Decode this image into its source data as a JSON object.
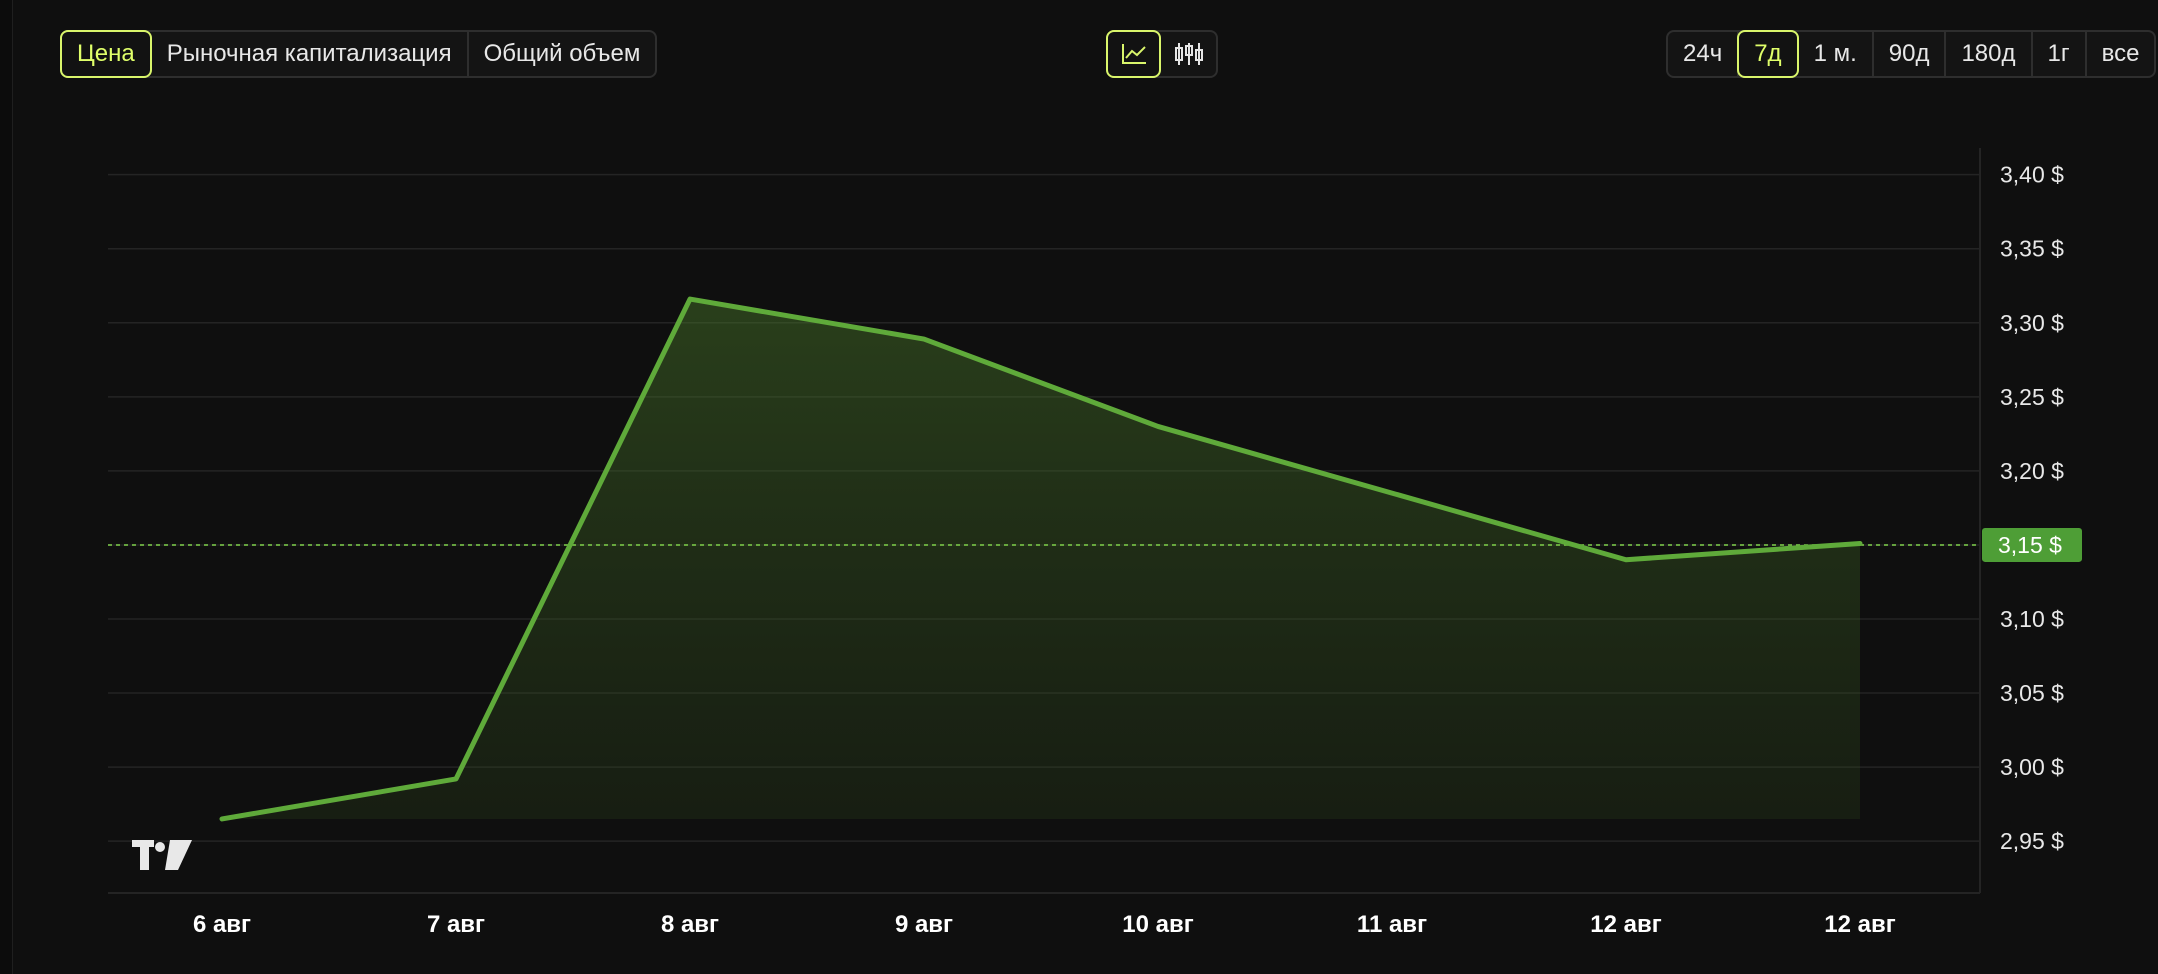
{
  "metric_tabs": [
    {
      "label": "Цена",
      "active": true
    },
    {
      "label": "Рыночная капитализация",
      "active": false
    },
    {
      "label": "Общий объем",
      "active": false
    }
  ],
  "view_toggle": [
    {
      "icon": "line-chart-icon",
      "active": true
    },
    {
      "icon": "candlestick-chart-icon",
      "active": false
    }
  ],
  "range_tabs": [
    {
      "label": "24ч",
      "active": false
    },
    {
      "label": "7д",
      "active": true
    },
    {
      "label": "1 м.",
      "active": false
    },
    {
      "label": "90д",
      "active": false
    },
    {
      "label": "180д",
      "active": false
    },
    {
      "label": "1г",
      "active": false
    },
    {
      "label": "все",
      "active": false
    }
  ],
  "colors": {
    "accent": "#d9f56b",
    "line": "#5faa3a",
    "price_tag": "#4e9e36",
    "background": "#0f0f0f"
  },
  "chart_data": {
    "type": "area",
    "x": [
      "6 авг",
      "7 авг",
      "8 авг",
      "9 авг",
      "10 авг",
      "11 авг",
      "12 авг",
      "12 авг"
    ],
    "series": [
      {
        "values": [
          2.965,
          2.992,
          3.316,
          3.289,
          3.23,
          3.185,
          3.14,
          3.151
        ]
      }
    ],
    "yticks": [
      2.95,
      3.0,
      3.05,
      3.1,
      3.15,
      3.2,
      3.25,
      3.3,
      3.35,
      3.4
    ],
    "ytick_labels": [
      "2,95 $",
      "3,00 $",
      "3,05 $",
      "3,10 $",
      "3,15 $",
      "3,20 $",
      "3,25 $",
      "3,30 $",
      "3,35 $",
      "3,40 $"
    ],
    "current_price": 3.15,
    "current_price_label": "3,15 $",
    "ylim": [
      2.915,
      3.418
    ],
    "grid": true,
    "y_axis_position": "right"
  }
}
